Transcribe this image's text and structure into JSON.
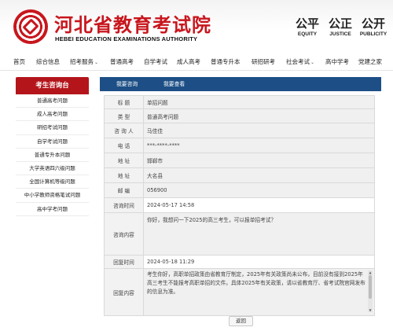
{
  "header": {
    "title_cn": "河北省教育考试院",
    "title_en": "HEBEI EDUCATION EXAMINATIONS AUTHORITY",
    "motto": [
      {
        "cn": "公平",
        "en": "EQUITY"
      },
      {
        "cn": "公正",
        "en": "JUSTICE"
      },
      {
        "cn": "公开",
        "en": "PUBLICITY"
      }
    ]
  },
  "nav": {
    "items": [
      {
        "label": "首页",
        "dropdown": false
      },
      {
        "label": "综合信息",
        "dropdown": false
      },
      {
        "label": "招考服务",
        "dropdown": true
      },
      {
        "label": "普通高考",
        "dropdown": false
      },
      {
        "label": "自学考试",
        "dropdown": false
      },
      {
        "label": "成人高考",
        "dropdown": false
      },
      {
        "label": "普通专升本",
        "dropdown": false
      },
      {
        "label": "研招研考",
        "dropdown": false
      },
      {
        "label": "社会考试",
        "dropdown": true
      },
      {
        "label": "高中学考",
        "dropdown": false
      },
      {
        "label": "党建之家",
        "dropdown": false
      }
    ]
  },
  "sidebar": {
    "heading": "考生咨询台",
    "items": [
      "普通高考问题",
      "成人高考问题",
      "研招考试问题",
      "自学考试问题",
      "普通专升本问题",
      "大学英语四六级问题",
      "全国计算机等级问题",
      "中小学教师资格笔试问题",
      "高中学考问题"
    ]
  },
  "tabs": [
    "我要咨询",
    "我要查看"
  ],
  "detail": {
    "rows": [
      {
        "label": "标  题",
        "value": "单招问题"
      },
      {
        "label": "类  型",
        "value": "普通高考问题"
      },
      {
        "label": "咨 询 人",
        "value": "马佳佳"
      },
      {
        "label": "电  话",
        "value": "***-****-****"
      },
      {
        "label": "地  址",
        "value": "邯郸市"
      },
      {
        "label": "地  址",
        "value": "大名县"
      },
      {
        "label": "邮  编",
        "value": "056900"
      },
      {
        "label": "咨询时间",
        "value": "2024-05-17 14:58"
      }
    ],
    "question_label": "咨询内容",
    "question": "你好，我想问一下2025的高三考生，可以报单招考试？",
    "reply_time_label": "回复时间",
    "reply_time": "2024-05-18 11:29",
    "reply_label": "回复内容",
    "reply": "考生你好，高职单招政策由省教育厅制定，2025年有关政策尚未公布，目前没有接到2025年高三考生不能报考高职单招的文件。具体2025年有关政策，请以省教育厅、省考试院官网发布的信息为准。"
  },
  "buttons": {
    "back": "返回"
  }
}
